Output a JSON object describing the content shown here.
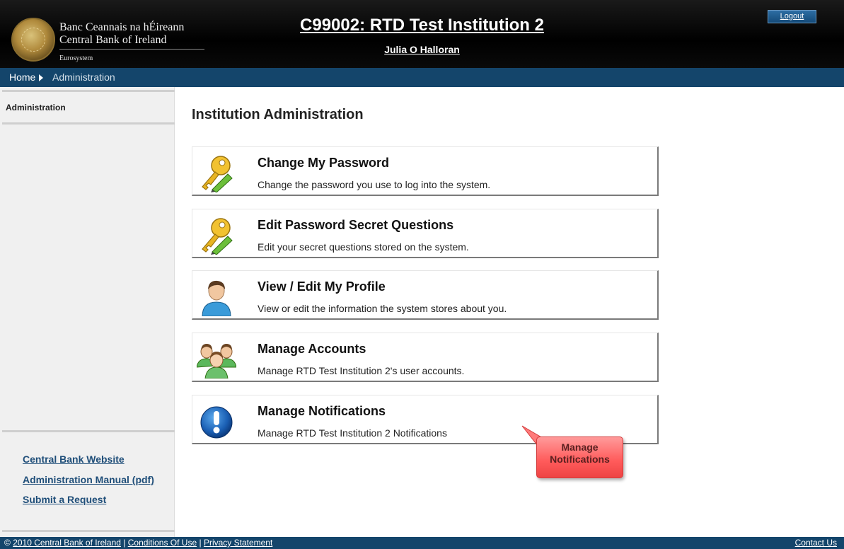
{
  "header": {
    "bank_name_irish": "Banc Ceannais na hÉireann",
    "bank_name_english": "Central Bank of Ireland",
    "eurosystem": "Eurosystem",
    "institution_title": "C99002: RTD Test Institution 2",
    "user_name": "Julia O Halloran",
    "logout_label": "Logout"
  },
  "breadcrumb": {
    "home": "Home",
    "current": "Administration"
  },
  "sidebar": {
    "title": "Administration",
    "links": [
      "Central Bank Website",
      "Administration Manual (pdf)",
      "Submit a Request"
    ]
  },
  "main": {
    "heading": "Institution Administration",
    "cards": [
      {
        "title": "Change My Password",
        "description": "Change the password you use to log into the system.",
        "icon": "key-pencil-icon"
      },
      {
        "title": "Edit Password Secret Questions",
        "description": "Edit your secret questions stored on the system.",
        "icon": "key-pencil-icon"
      },
      {
        "title": "View / Edit My Profile",
        "description": "View or edit the information the system stores about you.",
        "icon": "user-profile-icon"
      },
      {
        "title": "Manage Accounts",
        "description": "Manage RTD Test Institution 2's user accounts.",
        "icon": "user-group-icon"
      },
      {
        "title": "Manage Notifications",
        "description": "Manage RTD Test Institution 2 Notifications",
        "icon": "exclamation-icon"
      }
    ]
  },
  "callout": {
    "line1": "Manage",
    "line2": "Notifications"
  },
  "footer": {
    "copyright_prefix": "© ",
    "copyright_link": "2010 Central Bank of Ireland",
    "separator": " | ",
    "conditions": "Conditions Of Use",
    "privacy": "Privacy Statement",
    "contact": "Contact Us"
  },
  "colors": {
    "header_bg": "#000000",
    "nav_bar": "#14456b",
    "sidebar_bg": "#f0f0f0",
    "link": "#1f4e79",
    "callout": "#ff5a5a"
  }
}
